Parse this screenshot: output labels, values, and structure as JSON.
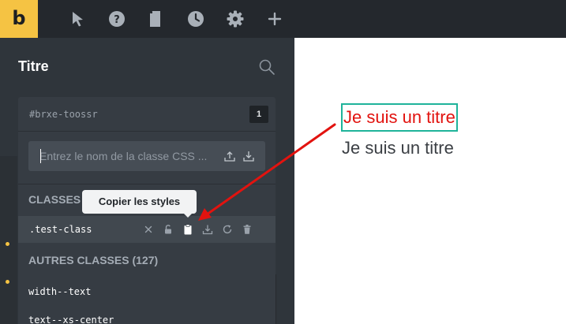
{
  "app": {
    "logo_letter": "b"
  },
  "toolbar": {
    "icons": [
      "pointer-icon",
      "help-icon",
      "page-icon",
      "history-icon",
      "gear-icon",
      "plus-icon"
    ]
  },
  "panel": {
    "title": "Titre"
  },
  "class_manager": {
    "element_id": "#brxe-toossr",
    "class_count": "1",
    "input_placeholder": "Entrez le nom de la classe CSS ...",
    "classes_label": "CLASSES",
    "active_class": ".test-class",
    "other_classes_label": "AUTRES CLASSES (127)",
    "other_classes": [
      "width--text",
      "text--xs-center"
    ]
  },
  "tooltip": {
    "text": "Copier les styles"
  },
  "canvas": {
    "heading_selected": "Je suis un titre",
    "heading_plain": "Je suis un titre"
  },
  "colors": {
    "toolbar_bg": "#24282d",
    "panel_bg": "#2f353b",
    "logo_bg": "#f5c343",
    "accent_red": "#e2130f",
    "selection_outline": "#1fb39a"
  }
}
